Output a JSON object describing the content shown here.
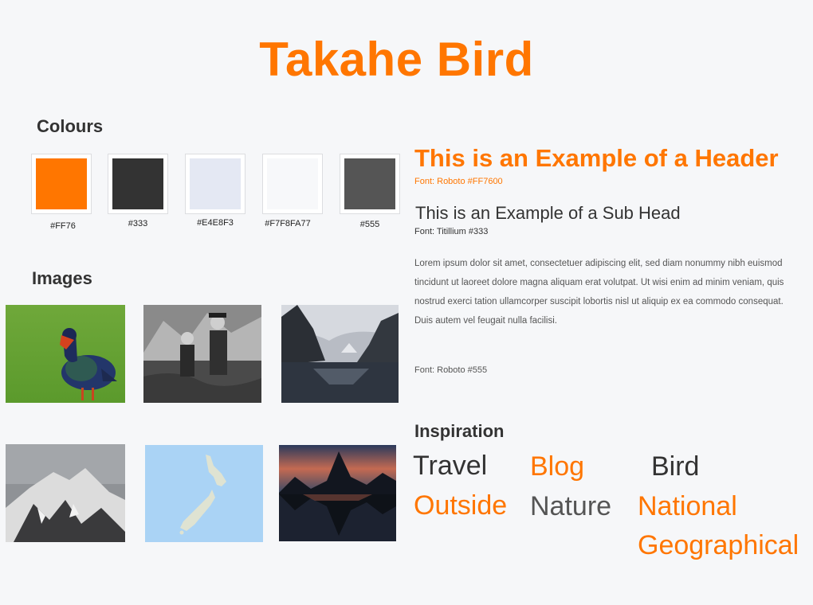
{
  "title": "Takahe Bird",
  "colours": {
    "heading": "Colours",
    "swatches": [
      {
        "label": "#FF76",
        "color": "#ff7600"
      },
      {
        "label": "#333",
        "color": "#333333"
      },
      {
        "label": "#E4E8F3",
        "color": "#e4e8f3"
      },
      {
        "label": "#F7F8FA77",
        "color": "#f7f8fa"
      },
      {
        "label": "#555",
        "color": "#555555"
      }
    ]
  },
  "images": {
    "heading": "Images"
  },
  "typography": {
    "header_example": "This is an Example of a Header",
    "header_font": "Font: Roboto #FF7600",
    "subhead_example": "This is an Example of a Sub Head",
    "subhead_font": "Font: Titillium #333",
    "body_example": "Lorem ipsum dolor sit amet, consectetuer adipiscing elit, sed diam nonummy nibh euismod tincidunt ut laoreet dolore magna aliquam erat volutpat. Ut wisi enim ad minim veniam, quis nostrud exerci tation ullamcorper suscipit lobortis nisl ut aliquip ex ea commodo consequat. Duis autem vel feugait nulla facilisi.",
    "body_font": "Font: Roboto #555"
  },
  "inspiration": {
    "heading": "Inspiration",
    "words": [
      "Travel",
      "Blog",
      "Bird",
      "Outside",
      "Nature",
      "National",
      "Geographical"
    ]
  }
}
